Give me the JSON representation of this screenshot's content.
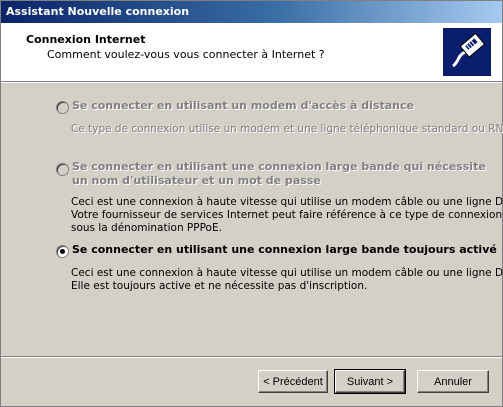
{
  "window": {
    "title": "Assistant Nouvelle connexion"
  },
  "header": {
    "title": "Connexion Internet",
    "subtitle": "Comment voulez-vous vous connecter à Internet ?",
    "icon": "network-plug-icon"
  },
  "options": [
    {
      "label": "Se connecter en utilisant un modem d'accès à distance",
      "enabled": false,
      "selected": false,
      "description": [
        "Ce type de connexion utilise un modem et une ligne téléphonique standard ou RNIS."
      ]
    },
    {
      "label": "Se connecter en utilisant une connexion large bande qui nécessite",
      "label_line2": "un nom d'utilisateur et un mot de passe",
      "enabled": false,
      "selected": false,
      "description": [
        "Ceci est une connexion à haute vitesse qui utilise un modem câble ou une ligne DSL.",
        "Votre fournisseur de services Internet peut faire référence à ce type de connexion",
        "sous la dénomination PPPoE."
      ]
    },
    {
      "label": "Se connecter en utilisant une connexion large bande toujours activé",
      "enabled": true,
      "selected": true,
      "description": [
        "Ceci est une connexion à haute vitesse qui utilise un modem câble ou une ligne DSL.",
        "Elle est toujours active et ne nécessite pas d'inscription."
      ]
    }
  ],
  "buttons": {
    "back": "< Précédent",
    "next": "Suivant >",
    "cancel": "Annuler"
  }
}
